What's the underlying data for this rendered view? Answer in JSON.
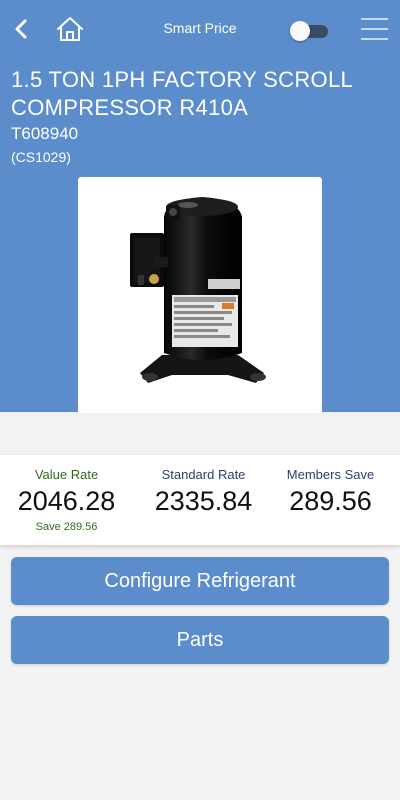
{
  "header": {
    "title": "Smart Price",
    "back_icon": "chevron-left-icon",
    "home_icon": "home-icon",
    "menu_icon": "hamburger-menu-icon",
    "toggle_on": false
  },
  "product": {
    "title": "1.5 TON 1PH FACTORY SCROLL COMPRESSOR R410A",
    "sku": "T608940",
    "code": "(CS1029)",
    "image": "scroll-compressor-image"
  },
  "pricing": {
    "value_rate_label": "Value Rate",
    "value_rate": "2046.28",
    "value_rate_save": "Save 289.56",
    "standard_rate_label": "Standard Rate",
    "standard_rate": "2335.84",
    "members_save_label": "Members Save",
    "members_save": "289.56"
  },
  "actions": {
    "configure_label": "Configure Refrigerant",
    "parts_label": "Parts"
  },
  "colors": {
    "primary": "#5b8ccc",
    "background": "#f2f2f2",
    "save_green": "#2f6b1c",
    "label_blue": "#2b3f66"
  }
}
